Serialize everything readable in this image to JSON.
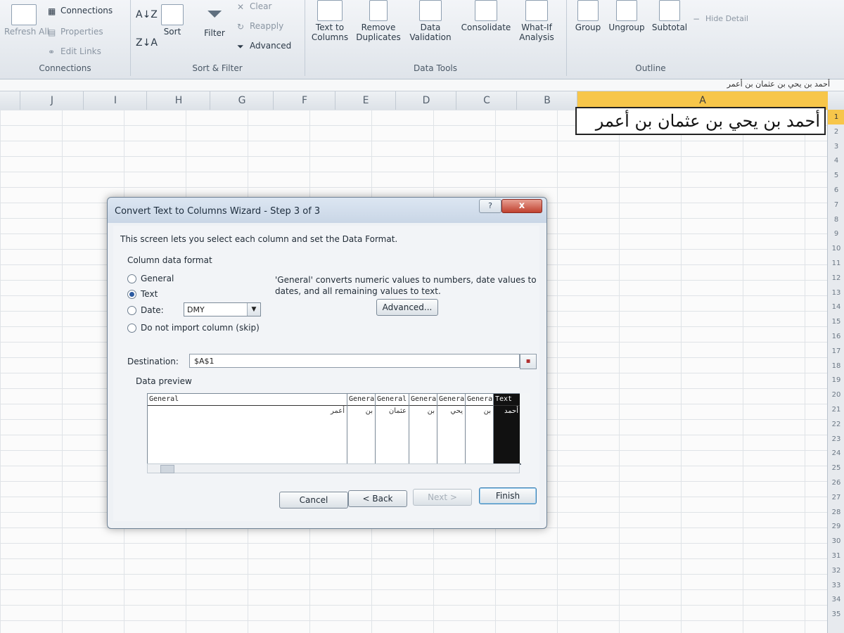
{
  "ribbon": {
    "groups": [
      {
        "label": "Connections"
      },
      {
        "label": "Sort & Filter"
      },
      {
        "label": "Data Tools"
      },
      {
        "label": "Outline"
      }
    ],
    "refresh_all": "Refresh All",
    "connections": "Connections",
    "properties": "Properties",
    "edit_links": "Edit Links",
    "sort": "Sort",
    "filter": "Filter",
    "clear": "Clear",
    "reapply": "Reapply",
    "advanced": "Advanced",
    "text_to_columns": "Text to Columns",
    "remove_duplicates": "Remove Duplicates",
    "data_validation": "Data Validation",
    "consolidate": "Consolidate",
    "what_if": "What-If Analysis",
    "group": "Group",
    "ungroup": "Ungroup",
    "subtotal": "Subtotal",
    "hide_detail": "Hide Detail"
  },
  "formula_bar": {
    "value": "أحمد بن يحي بن عثمان بن أعمر"
  },
  "columns": [
    "J",
    "I",
    "H",
    "G",
    "F",
    "E",
    "D",
    "C",
    "B",
    "A"
  ],
  "selected_column": "A",
  "rows": [
    "1",
    "2",
    "3",
    "4",
    "5",
    "6",
    "7",
    "8",
    "9",
    "10",
    "11",
    "12",
    "13",
    "14",
    "15",
    "16",
    "17",
    "18",
    "19",
    "20",
    "21",
    "22",
    "23",
    "24",
    "25",
    "26",
    "27",
    "28",
    "29",
    "30",
    "31",
    "32",
    "33",
    "34",
    "35"
  ],
  "cell_a1": "أحمد بن يحي بن عثمان بن أعمر",
  "dialog": {
    "title": "Convert Text to Columns Wizard - Step 3 of 3",
    "help_label": "?",
    "close_label": "x",
    "intro": "This screen lets you select each column and set the Data Format.",
    "column_data_format": "Column data format",
    "options": {
      "general": "General",
      "text": "Text",
      "date": "Date:",
      "skip": "Do not import column (skip)"
    },
    "selected_option": "text",
    "date_format": "DMY",
    "general_note_1": "'General' converts numeric values to numbers, date values to",
    "general_note_2": "dates, and all remaining values to text.",
    "advanced_label": "Advanced...",
    "destination_label": "Destination:",
    "destination_value": "$A$1",
    "data_preview_label": "Data preview",
    "preview_columns": [
      {
        "header": "General",
        "value": "أعمر"
      },
      {
        "header": "General",
        "value": "بن"
      },
      {
        "header": "General",
        "value": "عثمان"
      },
      {
        "header": "General",
        "value": "بن"
      },
      {
        "header": "General",
        "value": "يحي"
      },
      {
        "header": "General",
        "value": "بن"
      },
      {
        "header": "Text",
        "value": "أحمد"
      }
    ],
    "buttons": {
      "cancel": "Cancel",
      "back": "< Back",
      "next": "Next >",
      "finish": "Finish"
    }
  }
}
